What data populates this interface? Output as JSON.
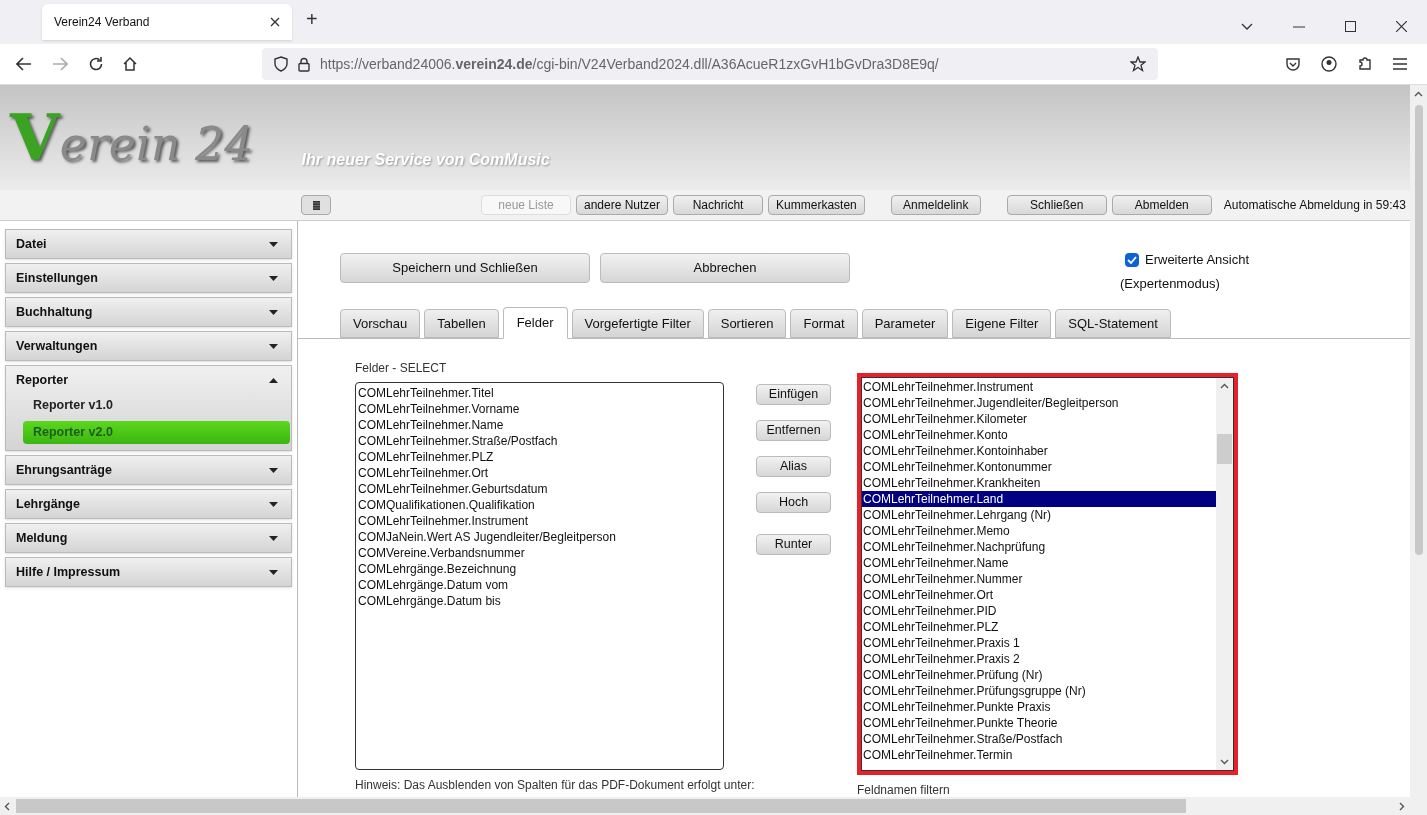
{
  "browser": {
    "tab_title": "Verein24 Verband",
    "new_tab": "+",
    "url": "https://verband24006.**verein24.de**/cgi-bin/V24Verband2024.dll/A36AcueR1zxGvH1bGvDra3D8E9q/"
  },
  "header": {
    "logo": "Verein 24",
    "tagline": "Ihr neuer Service von ComMusic"
  },
  "toolbar": {
    "buttons": [
      {
        "label": "neue Liste",
        "disabled": true,
        "gap": false
      },
      {
        "label": "andere Nutzer",
        "disabled": false,
        "gap": false
      },
      {
        "label": "Nachricht",
        "disabled": false,
        "gap": false
      },
      {
        "label": "Kummerkasten",
        "disabled": false,
        "gap": false
      },
      {
        "label": "Anmeldelink",
        "disabled": false,
        "gap": true
      },
      {
        "label": "Schließen",
        "disabled": false,
        "gap": true
      },
      {
        "label": "Abmelden",
        "disabled": false,
        "gap": false
      }
    ],
    "session": "Automatische Abmeldung in 59:43"
  },
  "sidebar": {
    "items": [
      {
        "label": "Datei",
        "expanded": false
      },
      {
        "label": "Einstellungen",
        "expanded": false
      },
      {
        "label": "Buchhaltung",
        "expanded": false
      },
      {
        "label": "Verwaltungen",
        "expanded": false
      },
      {
        "label": "Reporter",
        "expanded": true,
        "children": [
          {
            "label": "Reporter v1.0",
            "selected": false
          },
          {
            "label": "Reporter v2.0",
            "selected": true
          }
        ]
      },
      {
        "label": "Ehrungsanträge",
        "expanded": false
      },
      {
        "label": "Lehrgänge",
        "expanded": false
      },
      {
        "label": "Meldung",
        "expanded": false
      },
      {
        "label": "Hilfe / Impressum",
        "expanded": false
      }
    ]
  },
  "actions": [
    "Speichern und Schließen",
    "Abbrechen"
  ],
  "expert": {
    "label": "Erweiterte Ansicht",
    "note": "(Expertenmodus)",
    "checked": true
  },
  "tabs": [
    {
      "label": "Vorschau",
      "selected": false
    },
    {
      "label": "Tabellen",
      "selected": false
    },
    {
      "label": "Felder",
      "selected": true
    },
    {
      "label": "Vorgefertigte Filter",
      "selected": false
    },
    {
      "label": "Sortieren",
      "selected": false
    },
    {
      "label": "Format",
      "selected": false
    },
    {
      "label": "Parameter",
      "selected": false
    },
    {
      "label": "Eigene Filter",
      "selected": false
    },
    {
      "label": "SQL-Statement",
      "selected": false
    }
  ],
  "selected_fields": {
    "title": "Felder - SELECT",
    "items": [
      "COMLehrTeilnehmer.Titel",
      "COMLehrTeilnehmer.Vorname",
      "COMLehrTeilnehmer.Name",
      "COMLehrTeilnehmer.Straße/Postfach",
      "COMLehrTeilnehmer.PLZ",
      "COMLehrTeilnehmer.Ort",
      "COMLehrTeilnehmer.Geburtsdatum",
      "COMQualifikationen.Qualifikation",
      "COMLehrTeilnehmer.Instrument",
      "COMJaNein.Wert AS Jugendleiter/Begleitperson",
      "COMVereine.Verbandsnummer",
      "COMLehrgänge.Bezeichnung",
      "COMLehrgänge.Datum vom",
      "COMLehrgänge.Datum bis"
    ],
    "hint": "Hinweis: Das Ausblenden von Spalten für das PDF-Dokument erfolgt unter:"
  },
  "field_buttons": [
    "Einfügen",
    "Entfernen",
    "Alias",
    "Hoch",
    "Runter"
  ],
  "available_fields": {
    "items": [
      {
        "label": "COMLehrTeilnehmer.Instrument",
        "selected": false
      },
      {
        "label": "COMLehrTeilnehmer.Jugendleiter/Begleitperson",
        "selected": false
      },
      {
        "label": "COMLehrTeilnehmer.Kilometer",
        "selected": false
      },
      {
        "label": "COMLehrTeilnehmer.Konto",
        "selected": false
      },
      {
        "label": "COMLehrTeilnehmer.Kontoinhaber",
        "selected": false
      },
      {
        "label": "COMLehrTeilnehmer.Kontonummer",
        "selected": false
      },
      {
        "label": "COMLehrTeilnehmer.Krankheiten",
        "selected": false
      },
      {
        "label": "COMLehrTeilnehmer.Land",
        "selected": true
      },
      {
        "label": "COMLehrTeilnehmer.Lehrgang (Nr)",
        "selected": false
      },
      {
        "label": "COMLehrTeilnehmer.Memo",
        "selected": false
      },
      {
        "label": "COMLehrTeilnehmer.Nachprüfung",
        "selected": false
      },
      {
        "label": "COMLehrTeilnehmer.Name",
        "selected": false
      },
      {
        "label": "COMLehrTeilnehmer.Nummer",
        "selected": false
      },
      {
        "label": "COMLehrTeilnehmer.Ort",
        "selected": false
      },
      {
        "label": "COMLehrTeilnehmer.PID",
        "selected": false
      },
      {
        "label": "COMLehrTeilnehmer.PLZ",
        "selected": false
      },
      {
        "label": "COMLehrTeilnehmer.Praxis 1",
        "selected": false
      },
      {
        "label": "COMLehrTeilnehmer.Praxis 2",
        "selected": false
      },
      {
        "label": "COMLehrTeilnehmer.Prüfung (Nr)",
        "selected": false
      },
      {
        "label": "COMLehrTeilnehmer.Prüfungsgruppe (Nr)",
        "selected": false
      },
      {
        "label": "COMLehrTeilnehmer.Punkte Praxis",
        "selected": false
      },
      {
        "label": "COMLehrTeilnehmer.Punkte Theorie",
        "selected": false
      },
      {
        "label": "COMLehrTeilnehmer.Straße/Postfach",
        "selected": false
      },
      {
        "label": "COMLehrTeilnehmer.Termin",
        "selected": false
      }
    ],
    "filter_label": "Feldnamen filtern"
  }
}
